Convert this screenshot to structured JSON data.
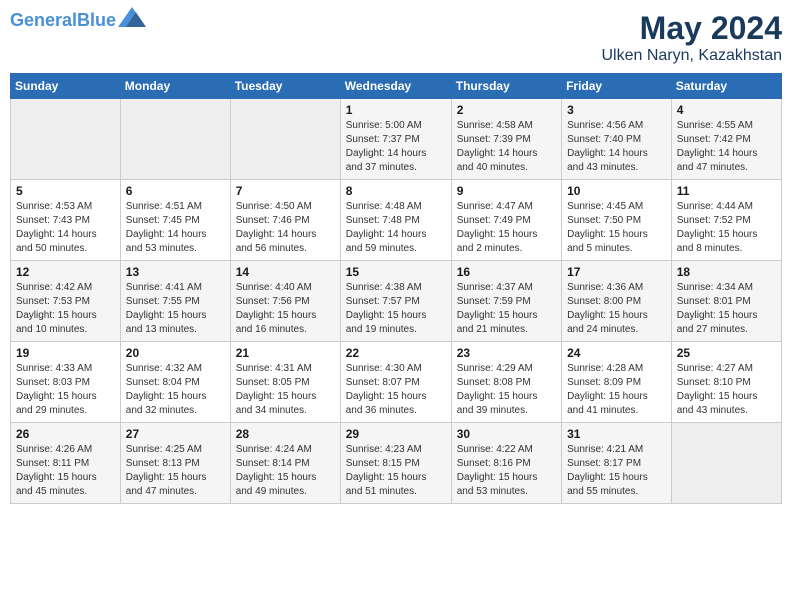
{
  "logo": {
    "text_general": "General",
    "text_blue": "Blue"
  },
  "title": {
    "month_year": "May 2024",
    "location": "Ulken Naryn, Kazakhstan"
  },
  "weekdays": [
    "Sunday",
    "Monday",
    "Tuesday",
    "Wednesday",
    "Thursday",
    "Friday",
    "Saturday"
  ],
  "weeks": [
    [
      {
        "day": "",
        "sunrise": "",
        "sunset": "",
        "daylight": ""
      },
      {
        "day": "",
        "sunrise": "",
        "sunset": "",
        "daylight": ""
      },
      {
        "day": "",
        "sunrise": "",
        "sunset": "",
        "daylight": ""
      },
      {
        "day": "1",
        "sunrise": "Sunrise: 5:00 AM",
        "sunset": "Sunset: 7:37 PM",
        "daylight": "Daylight: 14 hours and 37 minutes."
      },
      {
        "day": "2",
        "sunrise": "Sunrise: 4:58 AM",
        "sunset": "Sunset: 7:39 PM",
        "daylight": "Daylight: 14 hours and 40 minutes."
      },
      {
        "day": "3",
        "sunrise": "Sunrise: 4:56 AM",
        "sunset": "Sunset: 7:40 PM",
        "daylight": "Daylight: 14 hours and 43 minutes."
      },
      {
        "day": "4",
        "sunrise": "Sunrise: 4:55 AM",
        "sunset": "Sunset: 7:42 PM",
        "daylight": "Daylight: 14 hours and 47 minutes."
      }
    ],
    [
      {
        "day": "5",
        "sunrise": "Sunrise: 4:53 AM",
        "sunset": "Sunset: 7:43 PM",
        "daylight": "Daylight: 14 hours and 50 minutes."
      },
      {
        "day": "6",
        "sunrise": "Sunrise: 4:51 AM",
        "sunset": "Sunset: 7:45 PM",
        "daylight": "Daylight: 14 hours and 53 minutes."
      },
      {
        "day": "7",
        "sunrise": "Sunrise: 4:50 AM",
        "sunset": "Sunset: 7:46 PM",
        "daylight": "Daylight: 14 hours and 56 minutes."
      },
      {
        "day": "8",
        "sunrise": "Sunrise: 4:48 AM",
        "sunset": "Sunset: 7:48 PM",
        "daylight": "Daylight: 14 hours and 59 minutes."
      },
      {
        "day": "9",
        "sunrise": "Sunrise: 4:47 AM",
        "sunset": "Sunset: 7:49 PM",
        "daylight": "Daylight: 15 hours and 2 minutes."
      },
      {
        "day": "10",
        "sunrise": "Sunrise: 4:45 AM",
        "sunset": "Sunset: 7:50 PM",
        "daylight": "Daylight: 15 hours and 5 minutes."
      },
      {
        "day": "11",
        "sunrise": "Sunrise: 4:44 AM",
        "sunset": "Sunset: 7:52 PM",
        "daylight": "Daylight: 15 hours and 8 minutes."
      }
    ],
    [
      {
        "day": "12",
        "sunrise": "Sunrise: 4:42 AM",
        "sunset": "Sunset: 7:53 PM",
        "daylight": "Daylight: 15 hours and 10 minutes."
      },
      {
        "day": "13",
        "sunrise": "Sunrise: 4:41 AM",
        "sunset": "Sunset: 7:55 PM",
        "daylight": "Daylight: 15 hours and 13 minutes."
      },
      {
        "day": "14",
        "sunrise": "Sunrise: 4:40 AM",
        "sunset": "Sunset: 7:56 PM",
        "daylight": "Daylight: 15 hours and 16 minutes."
      },
      {
        "day": "15",
        "sunrise": "Sunrise: 4:38 AM",
        "sunset": "Sunset: 7:57 PM",
        "daylight": "Daylight: 15 hours and 19 minutes."
      },
      {
        "day": "16",
        "sunrise": "Sunrise: 4:37 AM",
        "sunset": "Sunset: 7:59 PM",
        "daylight": "Daylight: 15 hours and 21 minutes."
      },
      {
        "day": "17",
        "sunrise": "Sunrise: 4:36 AM",
        "sunset": "Sunset: 8:00 PM",
        "daylight": "Daylight: 15 hours and 24 minutes."
      },
      {
        "day": "18",
        "sunrise": "Sunrise: 4:34 AM",
        "sunset": "Sunset: 8:01 PM",
        "daylight": "Daylight: 15 hours and 27 minutes."
      }
    ],
    [
      {
        "day": "19",
        "sunrise": "Sunrise: 4:33 AM",
        "sunset": "Sunset: 8:03 PM",
        "daylight": "Daylight: 15 hours and 29 minutes."
      },
      {
        "day": "20",
        "sunrise": "Sunrise: 4:32 AM",
        "sunset": "Sunset: 8:04 PM",
        "daylight": "Daylight: 15 hours and 32 minutes."
      },
      {
        "day": "21",
        "sunrise": "Sunrise: 4:31 AM",
        "sunset": "Sunset: 8:05 PM",
        "daylight": "Daylight: 15 hours and 34 minutes."
      },
      {
        "day": "22",
        "sunrise": "Sunrise: 4:30 AM",
        "sunset": "Sunset: 8:07 PM",
        "daylight": "Daylight: 15 hours and 36 minutes."
      },
      {
        "day": "23",
        "sunrise": "Sunrise: 4:29 AM",
        "sunset": "Sunset: 8:08 PM",
        "daylight": "Daylight: 15 hours and 39 minutes."
      },
      {
        "day": "24",
        "sunrise": "Sunrise: 4:28 AM",
        "sunset": "Sunset: 8:09 PM",
        "daylight": "Daylight: 15 hours and 41 minutes."
      },
      {
        "day": "25",
        "sunrise": "Sunrise: 4:27 AM",
        "sunset": "Sunset: 8:10 PM",
        "daylight": "Daylight: 15 hours and 43 minutes."
      }
    ],
    [
      {
        "day": "26",
        "sunrise": "Sunrise: 4:26 AM",
        "sunset": "Sunset: 8:11 PM",
        "daylight": "Daylight: 15 hours and 45 minutes."
      },
      {
        "day": "27",
        "sunrise": "Sunrise: 4:25 AM",
        "sunset": "Sunset: 8:13 PM",
        "daylight": "Daylight: 15 hours and 47 minutes."
      },
      {
        "day": "28",
        "sunrise": "Sunrise: 4:24 AM",
        "sunset": "Sunset: 8:14 PM",
        "daylight": "Daylight: 15 hours and 49 minutes."
      },
      {
        "day": "29",
        "sunrise": "Sunrise: 4:23 AM",
        "sunset": "Sunset: 8:15 PM",
        "daylight": "Daylight: 15 hours and 51 minutes."
      },
      {
        "day": "30",
        "sunrise": "Sunrise: 4:22 AM",
        "sunset": "Sunset: 8:16 PM",
        "daylight": "Daylight: 15 hours and 53 minutes."
      },
      {
        "day": "31",
        "sunrise": "Sunrise: 4:21 AM",
        "sunset": "Sunset: 8:17 PM",
        "daylight": "Daylight: 15 hours and 55 minutes."
      },
      {
        "day": "",
        "sunrise": "",
        "sunset": "",
        "daylight": ""
      }
    ]
  ]
}
